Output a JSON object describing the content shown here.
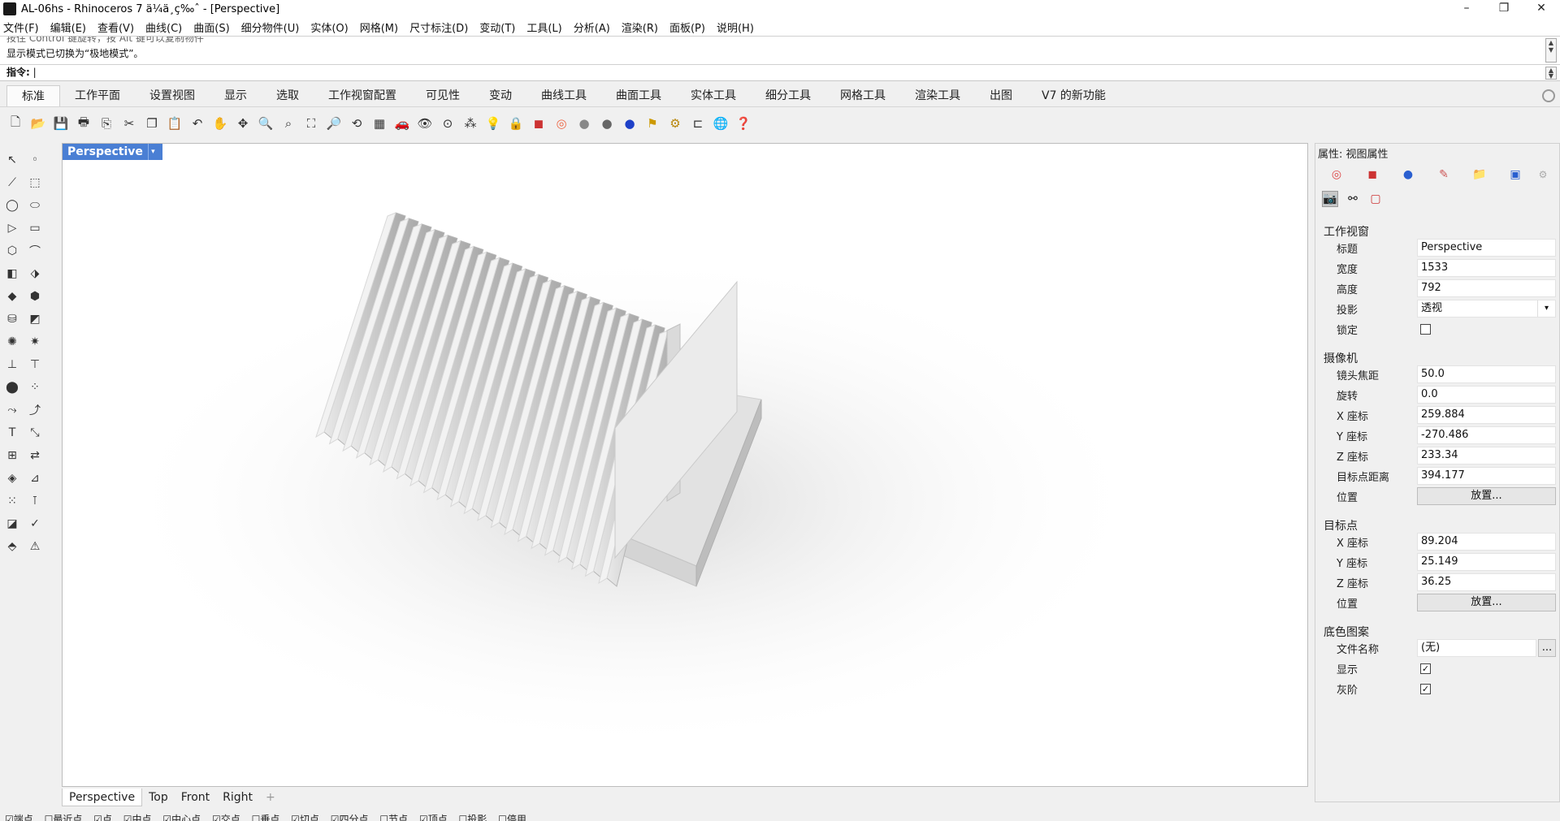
{
  "window": {
    "title": "AL-06hs - Rhinoceros 7 ä¼ä¸ç‰ˆ - [Perspective]",
    "minimize": "–",
    "maximize": "❐",
    "close": "✕"
  },
  "menu": [
    "文件(F)",
    "编辑(E)",
    "查看(V)",
    "曲线(C)",
    "曲面(S)",
    "细分物件(U)",
    "实体(O)",
    "网格(M)",
    "尺寸标注(D)",
    "变动(T)",
    "工具(L)",
    "分析(A)",
    "渲染(R)",
    "面板(P)",
    "说明(H)"
  ],
  "command": {
    "history_1": "按住 Control 键旋转，按 Alt 键可以复制物件",
    "history_2": "显示模式已切换为“极地模式”。",
    "prompt": "指令:"
  },
  "tabs": [
    "标准",
    "工作平面",
    "设置视图",
    "显示",
    "选取",
    "工作视窗配置",
    "可见性",
    "变动",
    "曲线工具",
    "曲面工具",
    "实体工具",
    "细分工具",
    "网格工具",
    "渲染工具",
    "出图",
    "V7 的新功能"
  ],
  "viewport": {
    "label": "Perspective",
    "dropdown": "▾"
  },
  "view_tabs": [
    "Perspective",
    "Top",
    "Front",
    "Right",
    "+"
  ],
  "osnap": [
    "☑端点",
    "☐最近点",
    "☑点",
    "☑中点",
    "☑中心点",
    "☑交点",
    "☐垂点",
    "☑切点",
    "☑四分点",
    "☐节点",
    "☑顶点",
    "☐投影",
    "☐停用"
  ],
  "panel": {
    "title": "属性: 视图属性",
    "viewport_section": "工作视窗",
    "title_label": "标题",
    "title_value": "Perspective",
    "width_label": "宽度",
    "width_value": "1533",
    "height_label": "高度",
    "height_value": "792",
    "projection_label": "投影",
    "projection_value": "透视",
    "lock_label": "锁定",
    "camera_section": "摄像机",
    "lens_label": "镜头焦距",
    "lens_value": "50.0",
    "rotation_label": "旋转",
    "rotation_value": "0.0",
    "cx_label": "X 座标",
    "cx_value": "259.884",
    "cy_label": "Y 座标",
    "cy_value": "-270.486",
    "cz_label": "Z 座标",
    "cz_value": "233.34",
    "target_dist_label": "目标点距离",
    "target_dist_value": "394.177",
    "position_label": "位置",
    "place_button": "放置...",
    "target_section": "目标点",
    "tx_label": "X 座标",
    "tx_value": "89.204",
    "ty_label": "Y 座标",
    "ty_value": "25.149",
    "tz_label": "Z 座标",
    "tz_value": "36.25",
    "tposition_label": "位置",
    "tplace_button": "放置...",
    "wallpaper_section": "底色图案",
    "filename_label": "文件名称",
    "filename_value": "(无)",
    "browse_button": "...",
    "show_label": "显示",
    "gray_label": "灰阶"
  }
}
